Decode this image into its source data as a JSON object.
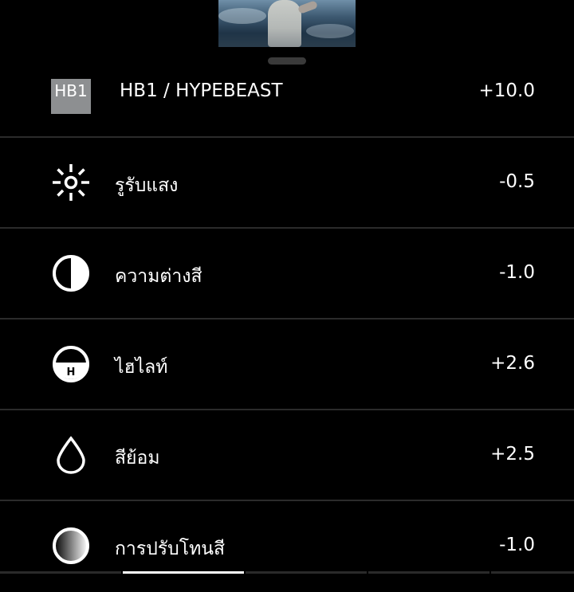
{
  "thumbnail": {
    "alt": ""
  },
  "adjustments": [
    {
      "icon": "hb1-preset-icon",
      "badge": "HB1",
      "label": "HB1 / HYPEBEAST",
      "value": "+10.0"
    },
    {
      "icon": "exposure-sun-icon",
      "label": "รูรับแสง",
      "value": "-0.5"
    },
    {
      "icon": "contrast-icon",
      "label": "ความต่างสี",
      "value": "-1.0"
    },
    {
      "icon": "highlights-icon",
      "icon_letter": "H",
      "label": "ไฮไลท์",
      "value": "+2.6"
    },
    {
      "icon": "saturation-drop-icon",
      "label": "สีย้อม",
      "value": "+2.5"
    },
    {
      "icon": "tone-gradient-icon",
      "label": "การปรับโทนสี",
      "value": "-1.0"
    }
  ],
  "colors": {
    "background": "#000000",
    "divider": "#2b2b2b",
    "badge": "#8d8f91",
    "handle": "#3a3a3a"
  }
}
